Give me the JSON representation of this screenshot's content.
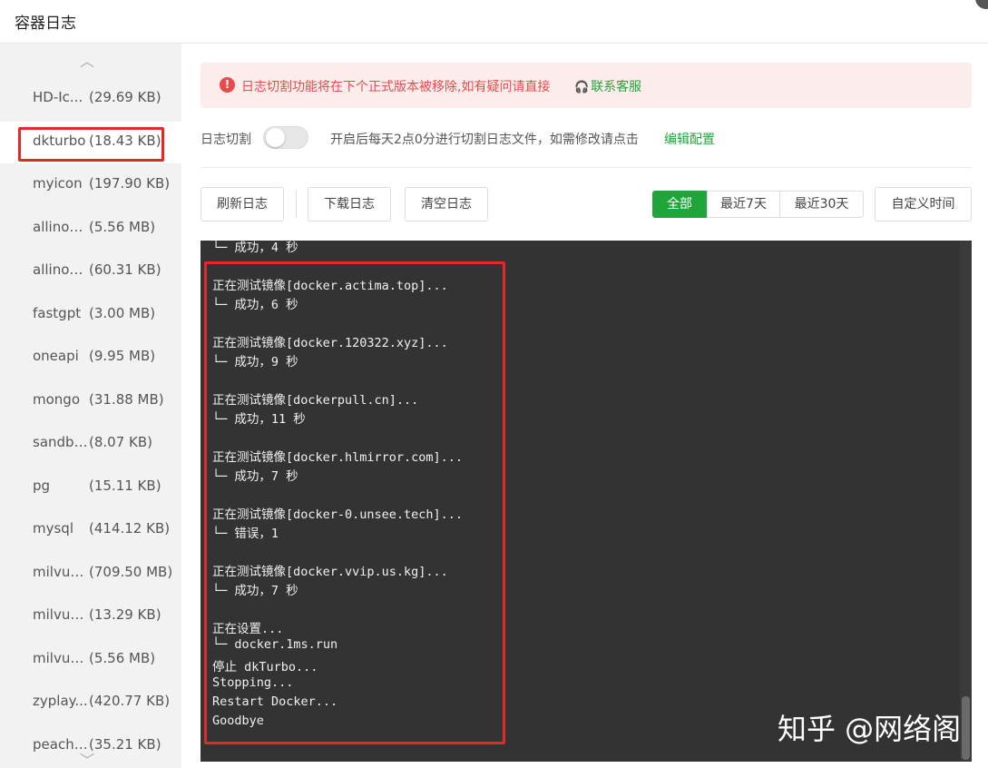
{
  "window": {
    "title": "容器日志"
  },
  "sidebar": {
    "items": [
      {
        "name": "HD-Ic...",
        "size": "(29.69 KB)"
      },
      {
        "name": "dkturbo",
        "size": "(18.43 KB)"
      },
      {
        "name": "myicon",
        "size": "(197.90 KB)"
      },
      {
        "name": "allinon...",
        "size": "(5.56 MB)"
      },
      {
        "name": "allinon...",
        "size": "(60.31 KB)"
      },
      {
        "name": "fastgpt",
        "size": "(3.00 MB)"
      },
      {
        "name": "oneapi",
        "size": "(9.95 MB)"
      },
      {
        "name": "mongo",
        "size": "(31.88 MB)"
      },
      {
        "name": "sandbox",
        "size": "(8.07 KB)"
      },
      {
        "name": "pg",
        "size": "(15.11 KB)"
      },
      {
        "name": "mysql",
        "size": "(414.12 KB)"
      },
      {
        "name": "milvus...",
        "size": "(709.50 MB)"
      },
      {
        "name": "milvus...",
        "size": "(13.29 KB)"
      },
      {
        "name": "milvus...",
        "size": "(5.56 MB)"
      },
      {
        "name": "zyplay...",
        "size": "(420.77 KB)"
      },
      {
        "name": "peaches",
        "size": "(35.21 KB)"
      }
    ],
    "selected_index": 1
  },
  "alert": {
    "message": "日志切割功能将在下个正式版本被移除,如有疑问请直接",
    "link": "联系客服"
  },
  "log_cut": {
    "label": "日志切割",
    "enabled": false,
    "description": "开启后每天2点0分进行切割日志文件，如需修改请点击",
    "edit_link": "编辑配置"
  },
  "toolbar": {
    "refresh": "刷新日志",
    "download": "下载日志",
    "clear": "清空日志",
    "range_all": "全部",
    "range_7": "最近7天",
    "range_30": "最近30天",
    "custom": "自定义时间"
  },
  "log": [
    "└─ 成功，4 秒",
    "",
    "正在测试镜像[docker.actima.top]...",
    "└─ 成功，6 秒",
    "",
    "正在测试镜像[docker.120322.xyz]...",
    "└─ 成功，9 秒",
    "",
    "正在测试镜像[dockerpull.cn]...",
    "└─ 成功，11 秒",
    "",
    "正在测试镜像[docker.hlmirror.com]...",
    "└─ 成功，7 秒",
    "",
    "正在测试镜像[docker-0.unsee.tech]...",
    "└─ 错误，1",
    "",
    "正在测试镜像[docker.vvip.us.kg]...",
    "└─ 成功，7 秒",
    "",
    "正在设置...",
    "└─ docker.1ms.run",
    "停止 dkTurbo...",
    "Stopping...",
    "Restart Docker...",
    "Goodbye"
  ],
  "watermark": "知乎 @网络阁",
  "colors": {
    "accent": "#20a53a",
    "error": "#e94b4b",
    "highlight": "#e02a2a",
    "terminal_bg": "#333333"
  }
}
